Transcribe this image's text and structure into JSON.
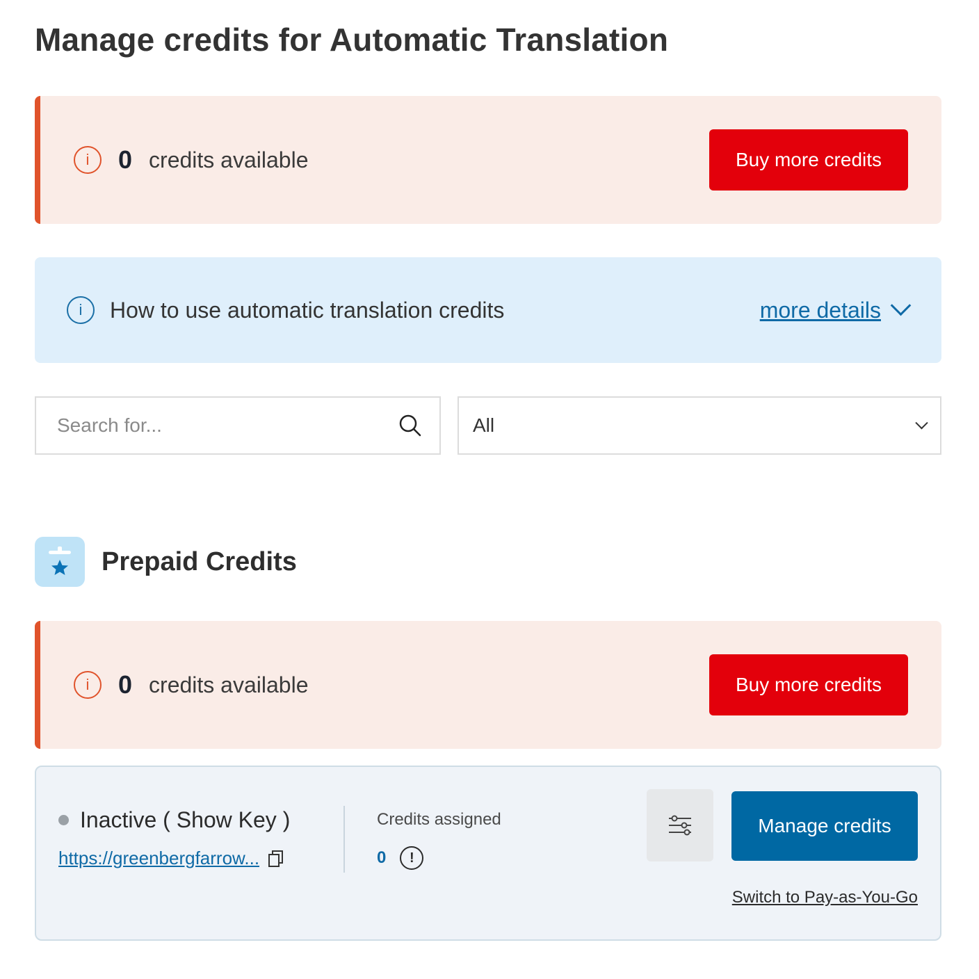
{
  "page": {
    "title": "Manage credits for Automatic Translation"
  },
  "summary": {
    "count": "0",
    "label": "credits available",
    "button": "Buy more credits"
  },
  "info": {
    "text": "How to use automatic translation credits",
    "link": "more details"
  },
  "filters": {
    "search_placeholder": "Search for...",
    "select_value": "All"
  },
  "prepaid": {
    "title": "Prepaid Credits",
    "count": "0",
    "label": "credits available",
    "button": "Buy more credits"
  },
  "key_card": {
    "status": "Inactive ( Show Key )",
    "status_color": "#9aa0a6",
    "site_url": "https://greenbergfarrow...",
    "assigned_label": "Credits assigned",
    "assigned_value": "0",
    "manage_button": "Manage credits",
    "switch_link": "Switch to Pay-as-You-Go"
  },
  "colors": {
    "warning_accent": "#e0532b",
    "buy_button": "#e3000b",
    "primary_button": "#0068a3",
    "link": "#0f6aa6",
    "info_bg": "#dfeffb",
    "warning_bg": "#faece7"
  },
  "icons": {
    "warning": "info-warning-icon",
    "info": "info-icon",
    "chevron": "chevron-down-icon",
    "search": "search-icon",
    "prepaid": "prepaid-star-icon",
    "copy": "copy-icon",
    "alert": "alert-icon",
    "settings": "sliders-icon"
  }
}
